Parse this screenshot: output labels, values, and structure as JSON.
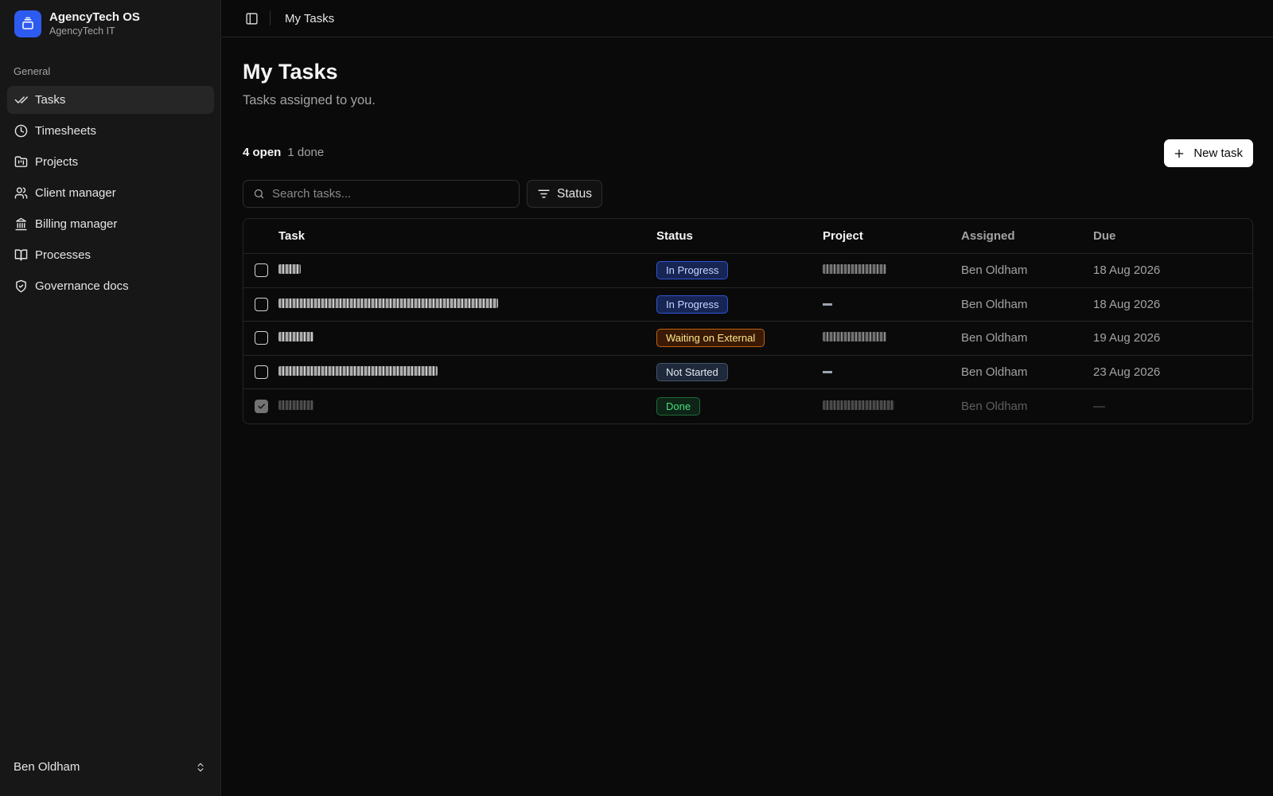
{
  "brand": {
    "name": "AgencyTech OS",
    "subtitle": "AgencyTech IT"
  },
  "sidebar": {
    "group_label": "General",
    "items": [
      {
        "label": "Tasks",
        "icon": "double-check-icon",
        "active": true
      },
      {
        "label": "Timesheets",
        "icon": "clock-icon",
        "active": false
      },
      {
        "label": "Projects",
        "icon": "folder-kanban-icon",
        "active": false
      },
      {
        "label": "Client manager",
        "icon": "users-icon",
        "active": false
      },
      {
        "label": "Billing manager",
        "icon": "landmark-icon",
        "active": false
      },
      {
        "label": "Processes",
        "icon": "book-open-icon",
        "active": false
      },
      {
        "label": "Governance docs",
        "icon": "shield-check-icon",
        "active": false
      }
    ],
    "user": "Ben Oldham"
  },
  "topbar": {
    "breadcrumb": "My Tasks"
  },
  "page": {
    "title": "My Tasks",
    "subtitle": "Tasks assigned to you.",
    "open_count": "4 open",
    "done_count": "1 done",
    "new_task_label": "New task"
  },
  "search": {
    "placeholder": "Search tasks..."
  },
  "filter": {
    "label": "Status"
  },
  "table": {
    "columns": [
      "Task",
      "Status",
      "Project",
      "Assigned",
      "Due"
    ],
    "rows": [
      {
        "checked": false,
        "status": "In Progress",
        "status_kind": "in-progress",
        "has_project": true,
        "assigned": "Ben Oldham",
        "due": "18 Aug 2026"
      },
      {
        "checked": false,
        "status": "In Progress",
        "status_kind": "in-progress",
        "has_project": false,
        "assigned": "Ben Oldham",
        "due": "18 Aug 2026"
      },
      {
        "checked": false,
        "status": "Waiting on External",
        "status_kind": "waiting",
        "has_project": true,
        "assigned": "Ben Oldham",
        "due": "19 Aug 2026"
      },
      {
        "checked": false,
        "status": "Not Started",
        "status_kind": "not-started",
        "has_project": false,
        "assigned": "Ben Oldham",
        "due": "23 Aug 2026"
      },
      {
        "checked": true,
        "status": "Done",
        "status_kind": "done",
        "has_project": true,
        "assigned": "Ben Oldham",
        "due": "—"
      }
    ]
  },
  "colors": {
    "accent": "#2e5bef",
    "background": "#0a0a0a",
    "sidebar": "#171717"
  }
}
